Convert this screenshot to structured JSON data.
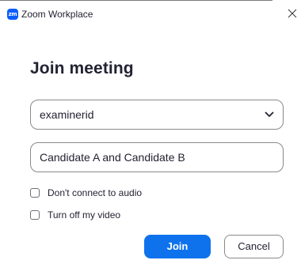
{
  "window": {
    "app_logo_text": "zm",
    "title": "Zoom Workplace",
    "close_icon": "close-icon"
  },
  "dialog": {
    "heading": "Join meeting",
    "meeting_id_value": "examinerid",
    "dropdown_icon": "chevron-down-icon",
    "name_value": "Candidate A and Candidate B",
    "options": {
      "audio_label": "Don't connect to audio",
      "audio_checked": false,
      "video_label": "Turn off my video",
      "video_checked": false
    },
    "join_label": "Join",
    "cancel_label": "Cancel"
  },
  "colors": {
    "accent": "#0e72ed",
    "logo": "#0b5cff",
    "text": "#232333",
    "border": "#8a8a8a"
  }
}
